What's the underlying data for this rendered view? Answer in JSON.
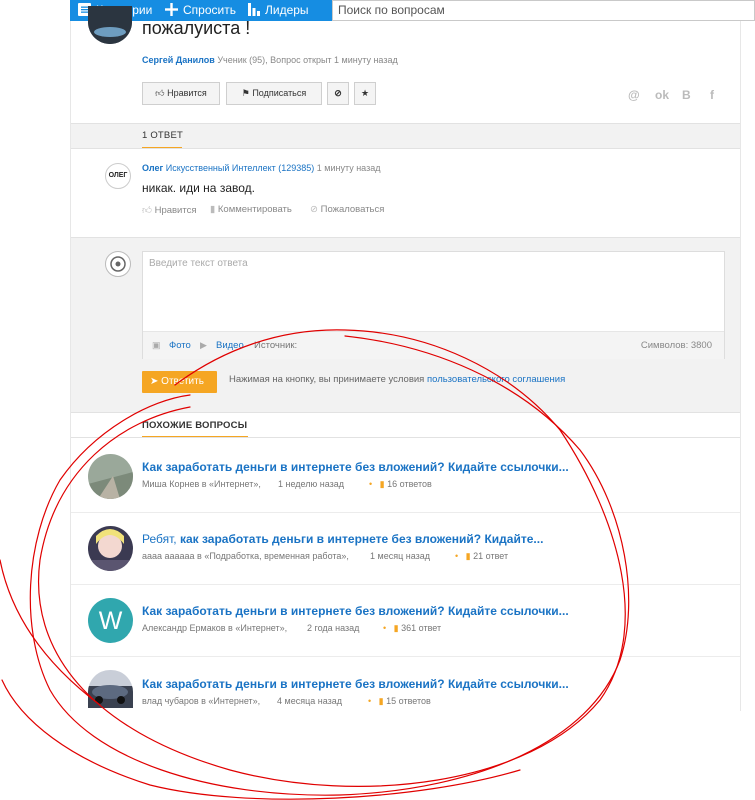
{
  "topbar": {
    "categories": "Категории",
    "ask": "Спросить",
    "leaders": "Лидеры",
    "search_placeholder": "Поиск по вопросам"
  },
  "question": {
    "title": "пожалуиста !",
    "author": "Сергей Данилов",
    "meta": "Ученик (95), Вопрос открыт 1 минуту назад",
    "like_label": "Нравится",
    "subscribe_label": "Подписаться",
    "social": [
      "@",
      "ok",
      "B",
      "f"
    ]
  },
  "answers": {
    "header": "1 ОТВЕТ",
    "items": [
      {
        "author": "Олег",
        "rank": "Искусственный Интеллект (129385)",
        "time": "1 минуту назад",
        "text": "никак. иди на завод.",
        "like": "Нравится",
        "comment": "Комментировать",
        "complain": "Пожаловаться",
        "avatar_text": "ОЛЕГ"
      }
    ]
  },
  "answer_form": {
    "placeholder": "Введите текст ответа",
    "photo": "Фото",
    "video": "Видео",
    "source": "Источник:",
    "chars": "Символов: 3800",
    "submit": "Ответить",
    "terms_text": "Нажимая на кнопку, вы принимаете условия",
    "terms_link": "пользовательского соглашения"
  },
  "similar": {
    "header": "ПОХОЖИЕ ВОПРОСЫ",
    "items": [
      {
        "prefix": "",
        "title": "Как заработать деньги в интернете без вложений? Кидайте ссылочки...",
        "author": "Миша Корнев в «Интернет»,",
        "time": "1 неделю назад",
        "answers": "16 ответов",
        "avatar": "photo-road"
      },
      {
        "prefix": "Ребят, ",
        "title": "как заработать деньги в интернете без вложений? Кидайте...",
        "author": "аааа аааааа в «Подработка, временная работа»,",
        "time": "1 месяц назад",
        "answers": "21 ответ",
        "avatar": "anime"
      },
      {
        "prefix": "",
        "title": "Как заработать деньги в интернете без вложений? Кидайте ссылочки...",
        "author": "Александр Ермаков в «Интернет»,",
        "time": "2 года назад",
        "answers": "361 ответ",
        "avatar": "W"
      },
      {
        "prefix": "",
        "title": "Как заработать деньги в интернете без вложений? Кидайте ссылочки...",
        "author": "влад чубаров в «Интернет»,",
        "time": "4 месяца назад",
        "answers": "15 ответов",
        "avatar": "photo-car"
      }
    ]
  },
  "colors": {
    "brand": "#168de2",
    "link": "#1a73c4",
    "accent": "#f5a623",
    "annotation": "#e00000"
  }
}
